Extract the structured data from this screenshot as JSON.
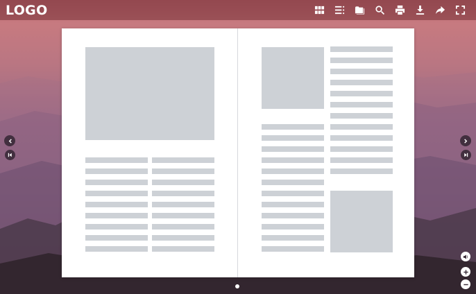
{
  "header": {
    "logo_text": "LOGO"
  },
  "toolbar": {
    "tools": [
      {
        "name": "thumbnails-icon"
      },
      {
        "name": "table-of-contents-icon"
      },
      {
        "name": "folder-icon"
      },
      {
        "name": "search-icon"
      },
      {
        "name": "print-icon"
      },
      {
        "name": "download-icon"
      },
      {
        "name": "share-icon"
      },
      {
        "name": "fullscreen-icon"
      }
    ]
  },
  "colors": {
    "toolbar_bg": "#78323780",
    "page_bg": "#ffffff",
    "placeholder": "#cdd1d6",
    "icon": "#ffffff"
  },
  "pagination": {
    "current_page": 1,
    "total_dots": 1
  }
}
